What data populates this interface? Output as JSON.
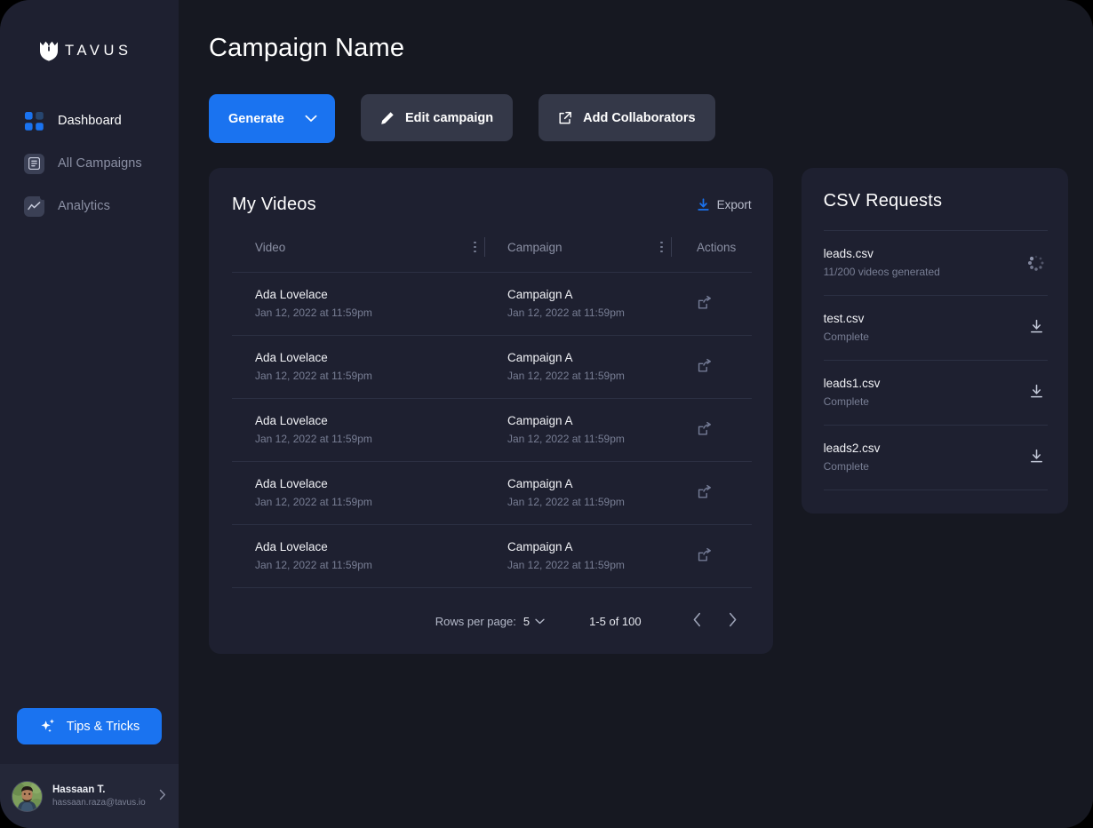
{
  "brand": {
    "logo_text": "TAVUS",
    "logo_icon": "crown-shield-icon",
    "accent_blue": "#1a73f0"
  },
  "sidebar": {
    "items": [
      {
        "label": "Dashboard",
        "icon": "grid-squares-icon",
        "active": true
      },
      {
        "label": "All Campaigns",
        "icon": "document-icon",
        "active": false
      },
      {
        "label": "Analytics",
        "icon": "chart-line-icon",
        "active": false
      }
    ],
    "tips_button": {
      "label": "Tips & Tricks",
      "icon": "sparkles-icon"
    },
    "user": {
      "name": "Hassaan T.",
      "email": "hassaan.raza@tavus.io",
      "chevron": "chevron-right-icon"
    }
  },
  "header": {
    "title": "Campaign Name",
    "buttons": [
      {
        "label": "Generate",
        "icon": "chevron-down-icon",
        "style": "primary"
      },
      {
        "label": "Edit campaign",
        "icon": "pencil-icon",
        "style": "secondary"
      },
      {
        "label": "Add Collaborators",
        "icon": "external-link-icon",
        "style": "secondary"
      }
    ]
  },
  "videos_card": {
    "title": "My Videos",
    "export": {
      "label": "Export",
      "icon": "download-icon"
    },
    "columns": {
      "video": "Video",
      "campaign": "Campaign",
      "actions": "Actions"
    },
    "rows": [
      {
        "video": "Ada Lovelace",
        "video_date": "Jan 12, 2022 at 11:59pm",
        "campaign": "Campaign A",
        "campaign_date": "Jan 12, 2022 at 11:59pm",
        "action_icon": "share-icon"
      },
      {
        "video": "Ada Lovelace",
        "video_date": "Jan 12, 2022 at 11:59pm",
        "campaign": "Campaign A",
        "campaign_date": "Jan 12, 2022 at 11:59pm",
        "action_icon": "share-icon"
      },
      {
        "video": "Ada Lovelace",
        "video_date": "Jan 12, 2022 at 11:59pm",
        "campaign": "Campaign A",
        "campaign_date": "Jan 12, 2022 at 11:59pm",
        "action_icon": "share-icon"
      },
      {
        "video": "Ada Lovelace",
        "video_date": "Jan 12, 2022 at 11:59pm",
        "campaign": "Campaign A",
        "campaign_date": "Jan 12, 2022 at 11:59pm",
        "action_icon": "share-icon"
      },
      {
        "video": "Ada Lovelace",
        "video_date": "Jan 12, 2022 at 11:59pm",
        "campaign": "Campaign A",
        "campaign_date": "Jan 12, 2022 at 11:59pm",
        "action_icon": "share-icon"
      }
    ],
    "pagination": {
      "rows_per_page_label": "Rows per page:",
      "rows_per_page_value": "5",
      "range": "1-5 of 100",
      "prev_icon": "chevron-left-icon",
      "next_icon": "chevron-right-icon"
    }
  },
  "csv_card": {
    "title": "CSV Requests",
    "items": [
      {
        "name": "leads.csv",
        "status": "11/200 videos generated",
        "action_icon": "spinner-icon"
      },
      {
        "name": "test.csv",
        "status": "Complete",
        "action_icon": "download-icon"
      },
      {
        "name": "leads1.csv",
        "status": "Complete",
        "action_icon": "download-icon"
      },
      {
        "name": "leads2.csv",
        "status": "Complete",
        "action_icon": "download-icon"
      }
    ]
  }
}
